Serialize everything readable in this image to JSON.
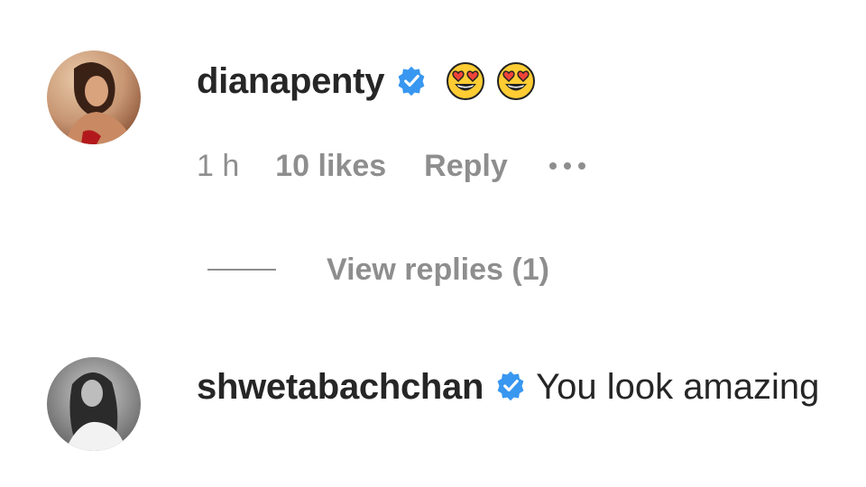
{
  "comments": [
    {
      "username": "dianapenty",
      "verified": true,
      "text_emojis": [
        "heart-eyes-emoji",
        "heart-eyes-emoji"
      ],
      "time": "1 h",
      "likes": "10 likes",
      "reply_label": "Reply",
      "more_icon": "ellipsis-icon",
      "view_replies": "View replies (1)"
    },
    {
      "username": "shwetabachchan",
      "verified": true,
      "text": "You look amazing"
    }
  ],
  "colors": {
    "primary_text": "#262626",
    "secondary_text": "#8e8e8e",
    "verified_blue": "#3897f0",
    "emoji_yellow": "#ffcc33",
    "heart_red": "#f0443a"
  }
}
